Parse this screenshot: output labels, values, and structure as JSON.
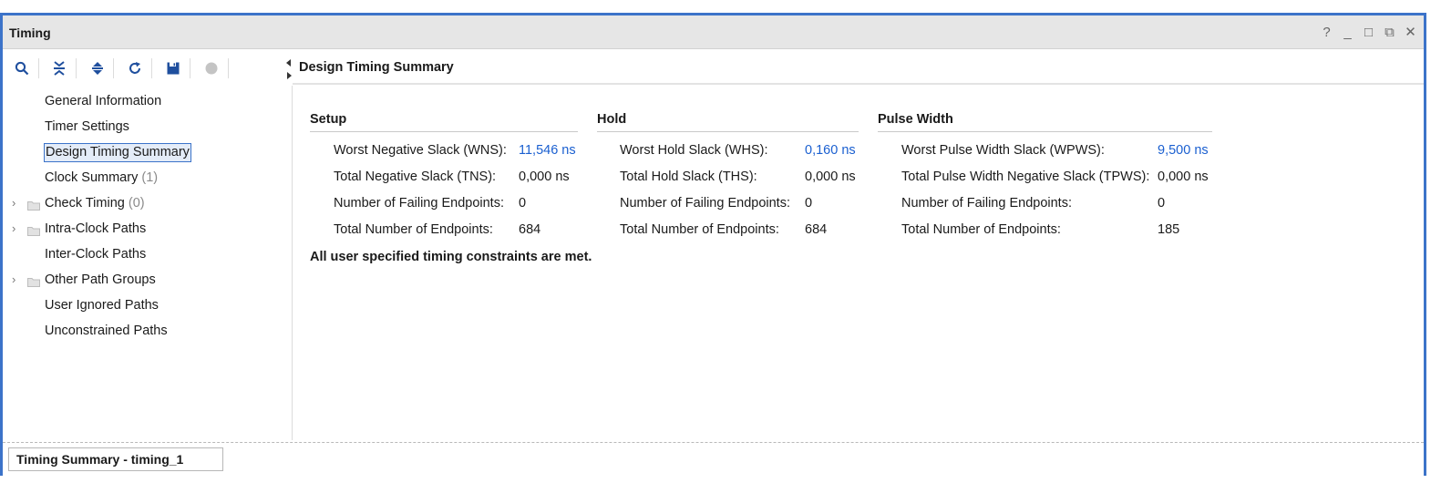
{
  "window": {
    "title": "Timing",
    "controls": [
      "?",
      "_",
      "□",
      "⧉",
      "✕"
    ]
  },
  "toolbar": {
    "icons": [
      "search-icon",
      "collapse-all-icon",
      "expand-all-icon",
      "refresh-icon",
      "save-icon",
      "stop-icon"
    ]
  },
  "tree": {
    "items": [
      {
        "label": "General Information",
        "count": ""
      },
      {
        "label": "Timer Settings",
        "count": ""
      },
      {
        "label": "Design Timing Summary",
        "count": "",
        "selected": true
      },
      {
        "label": "Clock Summary",
        "count": "(1)"
      },
      {
        "label": "Check Timing",
        "count": "(0)",
        "expandable": true
      },
      {
        "label": "Intra-Clock Paths",
        "count": "",
        "expandable": true
      },
      {
        "label": "Inter-Clock Paths",
        "count": ""
      },
      {
        "label": "Other Path Groups",
        "count": "",
        "expandable": true
      },
      {
        "label": "User Ignored Paths",
        "count": ""
      },
      {
        "label": "Unconstrained Paths",
        "count": ""
      }
    ]
  },
  "content": {
    "title": "Design Timing Summary",
    "setup": {
      "title": "Setup",
      "rows": [
        {
          "label": "Worst Negative Slack (WNS):",
          "value": "11,546 ns",
          "link": true
        },
        {
          "label": "Total Negative Slack (TNS):",
          "value": "0,000 ns"
        },
        {
          "label": "Number of Failing Endpoints:",
          "value": "0"
        },
        {
          "label": "Total Number of Endpoints:",
          "value": "684"
        }
      ]
    },
    "hold": {
      "title": "Hold",
      "rows": [
        {
          "label": "Worst Hold Slack (WHS):",
          "value": "0,160 ns",
          "link": true
        },
        {
          "label": "Total Hold Slack (THS):",
          "value": "0,000 ns"
        },
        {
          "label": "Number of Failing Endpoints:",
          "value": "0"
        },
        {
          "label": "Total Number of Endpoints:",
          "value": "684"
        }
      ]
    },
    "pulse": {
      "title": "Pulse Width",
      "rows": [
        {
          "label": "Worst Pulse Width Slack (WPWS):",
          "value": "9,500 ns",
          "link": true
        },
        {
          "label": "Total Pulse Width Negative Slack (TPWS):",
          "value": "0,000 ns"
        },
        {
          "label": "Number of Failing Endpoints:",
          "value": "0"
        },
        {
          "label": "Total Number of Endpoints:",
          "value": "185"
        }
      ]
    },
    "status": "All user specified timing constraints are met."
  },
  "bottom_tab": {
    "label": "Timing Summary - timing_1"
  },
  "colors": {
    "frame_border": "#3c73c9",
    "link": "#1a5fd0",
    "toolbar_icon": "#1f4f9e"
  }
}
